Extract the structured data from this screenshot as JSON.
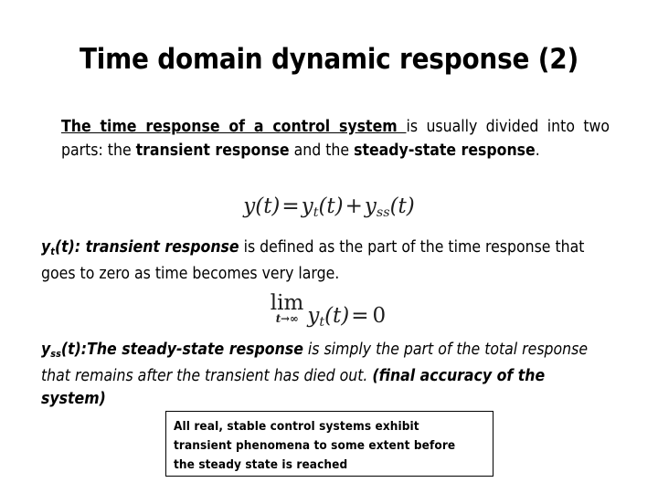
{
  "slide": {
    "title": "Time domain dynamic response (2)",
    "background_color": "#ffffff",
    "text_color": "#000000"
  },
  "intro_paragraph": {
    "underlined_bold": "The time response of a control system ",
    "text_1": "is usually divided into two parts: the ",
    "bold_1": "transient response",
    "text_2": " and the ",
    "bold_2": "steady-state response",
    "text_3": "."
  },
  "equation_total": {
    "lhs_y": "y",
    "lhs_arg": "(t)",
    "equals": "=",
    "term1_y": "y",
    "term1_sub": "t",
    "term1_arg": "(t)",
    "plus": "+",
    "term2_y": "y",
    "term2_sub": "ss",
    "term2_arg": "(t)",
    "plain": "y(t) = y_t(t) + y_ss(t)"
  },
  "transient_paragraph": {
    "lead_y": "y",
    "lead_sub": "t",
    "lead_rest": "(t): transient response",
    "body": " is defined as the part of the time response that goes to zero as time becomes very large."
  },
  "equation_limit": {
    "lim_word": "lim",
    "lim_sub": "t→∞",
    "y": "y",
    "y_sub": "t",
    "arg": "(t)",
    "equals": "=",
    "rhs": "0",
    "plain": "lim (t→∞) y_t(t) = 0"
  },
  "steady_paragraph": {
    "lead_y": "y",
    "lead_sub": "ss",
    "lead_rest": "(t):The steady-state response",
    "body": " is simply the part of the total response that remains after the transient has died out. ",
    "tail": "(final accuracy of the system)"
  },
  "callout": {
    "line1": "All real, stable control systems exhibit",
    "line2": "transient phenomena to some extent before",
    "line3": "the steady state is reached",
    "border_color": "#000000"
  }
}
